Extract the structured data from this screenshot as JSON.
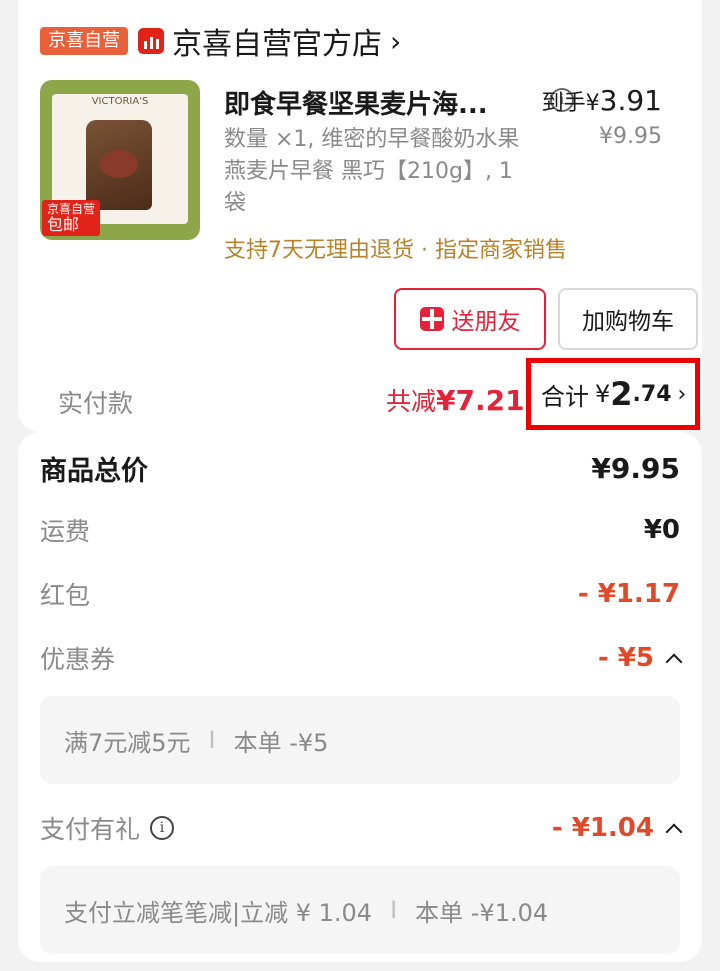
{
  "store": {
    "tag": "京喜自营",
    "name": "京喜自营官方店",
    "chevron": "›"
  },
  "product": {
    "image_brand_text": "VICTORIA'S",
    "image_ship_line1": "京喜自营",
    "image_ship_line2": "包邮",
    "title": "即食早餐坚果麦片海...",
    "daoshou_label": "到手",
    "daoshou_currency": "¥",
    "daoshou_price": "3.91",
    "original_price": "¥9.95",
    "desc": "数量 ×1, 维密的早餐酸奶水果燕麦片早餐 黑巧【210g】, 1袋",
    "policy": "支持7天无理由退货 · 指定商家销售",
    "icons": {
      "info": "info-circle-icon",
      "gift": "gift-icon",
      "store": "store-bars-icon"
    }
  },
  "buttons": {
    "gift": "送朋友",
    "cart": "加购物车"
  },
  "payment": {
    "label": "实付款",
    "reduced_label": "共减",
    "reduced_amount": "¥7.21",
    "total_label": "合计",
    "total_currency": "¥",
    "total_int": "2",
    "total_dec": ".74",
    "chevron": "›"
  },
  "breakdown": {
    "goods_total_label": "商品总价",
    "goods_total_value": "¥9.95",
    "shipping_label": "运费",
    "shipping_value": "¥0",
    "redpacket_label": "红包",
    "redpacket_value": "- ¥1.17",
    "coupon_label": "优惠券",
    "coupon_value": "- ¥5",
    "coupon_detail": "满7元减5元",
    "coupon_detail_sep": "I",
    "coupon_detail_amount": "本单 -¥5",
    "paygift_label": "支付有礼",
    "paygift_value": "- ¥1.04",
    "paygift_detail": "支付立减笔笔减|立减 ¥ 1.04",
    "paygift_detail_sep": "I",
    "paygift_detail_amount": "本单 -¥1.04",
    "colors": {
      "red": "#e04a2a",
      "gold": "#b8822a",
      "brand": "#e2233a"
    }
  }
}
